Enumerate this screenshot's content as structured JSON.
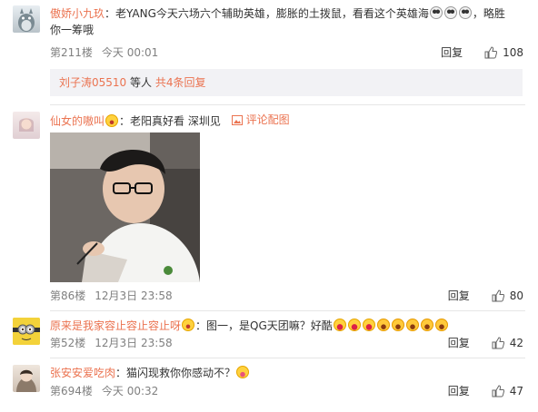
{
  "comments": [
    {
      "username": "傲娇小九玖",
      "text": "：老YANG今天六场六个辅助英雄，膨胀的土拨鼠，看看这个英雄海",
      "text_after_emoji": "，略胜",
      "text_line2": "你一筹哦",
      "emojis": [
        "panda-emoji",
        "panda-emoji",
        "panda-emoji"
      ],
      "floor": "第211楼",
      "time": "今天 00:01",
      "reply_label": "回复",
      "likes": "108",
      "sub_replies": {
        "user": "刘子涛05510",
        "middle": " 等人 ",
        "count_link": "共4条回复"
      }
    },
    {
      "username": "仙女的嗷叫",
      "badge_emoji": "girl-emoji",
      "text": "：老阳真好看 深圳见",
      "attachment_label": "评论配图",
      "floor": "第86楼",
      "time": "12月3日 23:58",
      "reply_label": "回复",
      "likes": "80"
    },
    {
      "username": "原来是我家容止容止容止呀",
      "badge_emoji": "girl-emoji",
      "text": "：图一，是QG天团嘛？好酷",
      "emojis": [
        "laugh-emoji",
        "laugh-emoji",
        "laugh-emoji",
        "shock-emoji",
        "shock-emoji",
        "shock-emoji",
        "shock-emoji",
        "shock-emoji"
      ],
      "floor": "第52楼",
      "time": "12月3日 23:58",
      "reply_label": "回复",
      "likes": "42"
    },
    {
      "username": "张安安爱吃肉",
      "text": "：猫闪现救你你感动不？",
      "emojis": [
        "yum-emoji"
      ],
      "floor": "第694楼",
      "time": "今天 00:32",
      "reply_label": "回复",
      "likes": "47"
    }
  ]
}
